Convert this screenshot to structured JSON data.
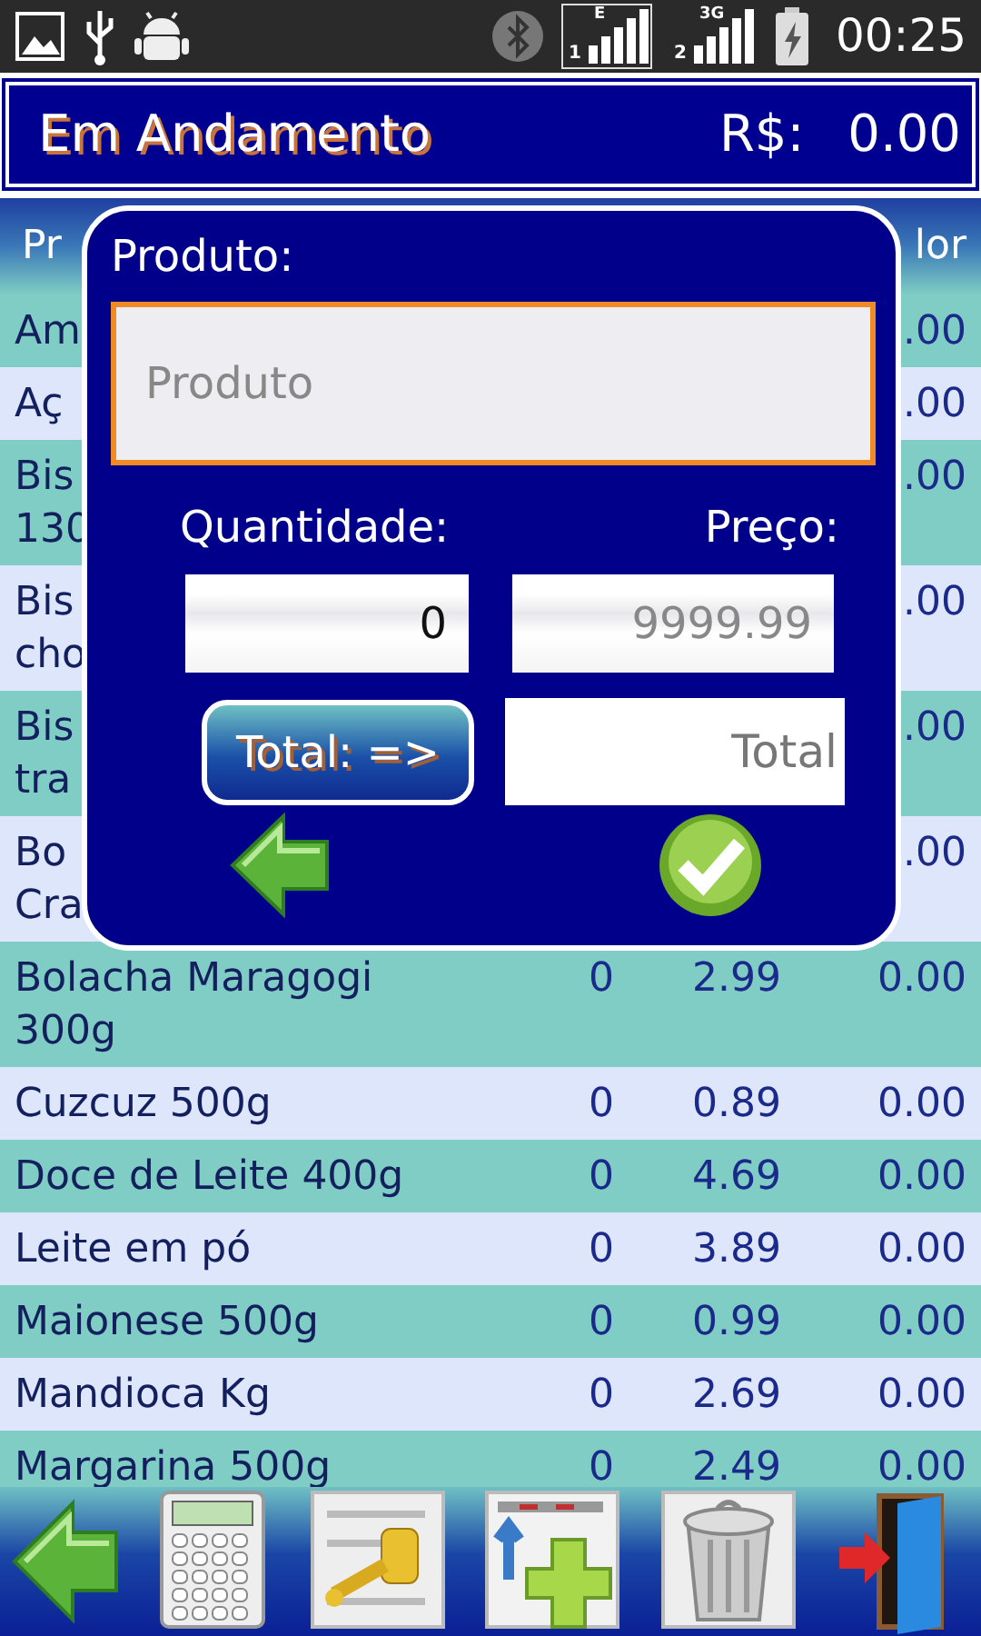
{
  "status_bar": {
    "signal_1": {
      "network": "E",
      "sim": "1",
      "highlighted": true
    },
    "signal_2": {
      "network": "3G",
      "sim": "2",
      "highlighted": false
    },
    "time": "00:25"
  },
  "title_bar": {
    "title": "Em Andamento",
    "total_label": "R$:",
    "total": "0.00"
  },
  "table": {
    "headings": [
      {
        "text": "Pr",
        "kind": "left"
      },
      {
        "text": "lor",
        "kind": "right"
      }
    ],
    "rows": [
      {
        "product": "Am",
        "value": ".00"
      },
      {
        "product": "Aç",
        "value": ".00"
      },
      {
        "product": "Bis\n130",
        "value": ".00"
      },
      {
        "product": "Bis\ncho",
        "value": ".00"
      },
      {
        "product": "Bis\ntra",
        "value": ".00"
      },
      {
        "product": "Bo\nCra",
        "value": ".00"
      },
      {
        "product": "Bolacha Maragogi 300g",
        "quantity": "0",
        "price": "2.99",
        "value": "0.00"
      },
      {
        "product": "Cuzcuz 500g",
        "quantity": "0",
        "price": "0.89",
        "value": "0.00"
      },
      {
        "product": "Doce de Leite 400g",
        "quantity": "0",
        "price": "4.69",
        "value": "0.00"
      },
      {
        "product": "Leite em pó",
        "quantity": "0",
        "price": "3.89",
        "value": "0.00"
      },
      {
        "product": "Maionese 500g",
        "quantity": "0",
        "price": "0.99",
        "value": "0.00"
      },
      {
        "product": "Mandioca Kg",
        "quantity": "0",
        "price": "2.69",
        "value": "0.00"
      },
      {
        "product": "Margarina 500g",
        "quantity": "0",
        "price": "2.49",
        "value": "0.00"
      }
    ]
  },
  "dialog": {
    "product_label": "Produto:",
    "product_field": {
      "placeholder": "Produto",
      "focused": true
    },
    "quantity_label": "Quantidade:",
    "price_label": "Preço:",
    "quantity_field": {
      "value": "0"
    },
    "price_field": {
      "placeholder": "9999.99"
    },
    "total_button": "Total: =>",
    "total_field": {
      "placeholder": "Total"
    },
    "actions": [
      {
        "kind": "back"
      },
      {
        "kind": "confirm"
      }
    ]
  },
  "toolbar": [
    {
      "kind": "back"
    },
    {
      "kind": "calculator"
    },
    {
      "kind": "key"
    },
    {
      "kind": "add"
    },
    {
      "kind": "trash"
    },
    {
      "kind": "exit"
    }
  ]
}
